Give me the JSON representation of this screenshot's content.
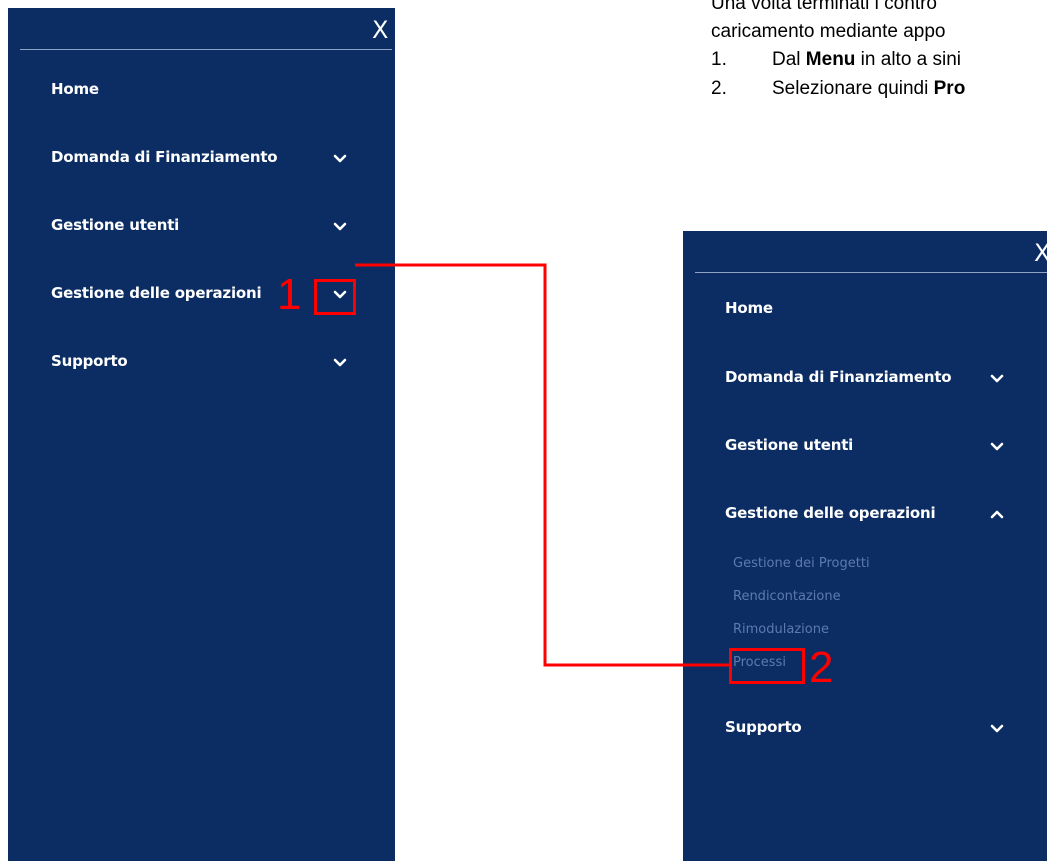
{
  "document": {
    "line1": "Una volta terminati i contro",
    "line2": "caricamento mediante appo",
    "step1": {
      "number": "1.",
      "prefix": "Dal ",
      "bold": "Menu",
      "suffix": " in alto a sini"
    },
    "step2": {
      "number": "2.",
      "prefix": "Selezionare quindi ",
      "bold": "Pro"
    }
  },
  "left_menu": {
    "close_label": "X",
    "items": [
      {
        "label": "Home",
        "has_chevron": false
      },
      {
        "label": "Domanda di Finanziamento",
        "chevron": "down"
      },
      {
        "label": "Gestione utenti",
        "chevron": "down"
      },
      {
        "label": "Gestione delle operazioni",
        "chevron": "down"
      },
      {
        "label": "Supporto",
        "chevron": "down"
      }
    ]
  },
  "right_menu": {
    "close_label": "X",
    "items": [
      {
        "label": "Home",
        "has_chevron": false
      },
      {
        "label": "Domanda di Finanziamento",
        "chevron": "down"
      },
      {
        "label": "Gestione utenti",
        "chevron": "down"
      },
      {
        "label": "Gestione delle operazioni",
        "chevron": "up"
      },
      {
        "label": "Supporto",
        "chevron": "down"
      }
    ],
    "submenu": [
      "Gestione dei Progetti",
      "Rendicontazione",
      "Rimodulazione",
      "Processi"
    ]
  },
  "annotations": {
    "step1_number": "1",
    "step2_number": "2"
  },
  "colors": {
    "panel_bg": "#0b2d64",
    "submenu_text": "#5c7ab0",
    "annotation": "#ff0000"
  }
}
